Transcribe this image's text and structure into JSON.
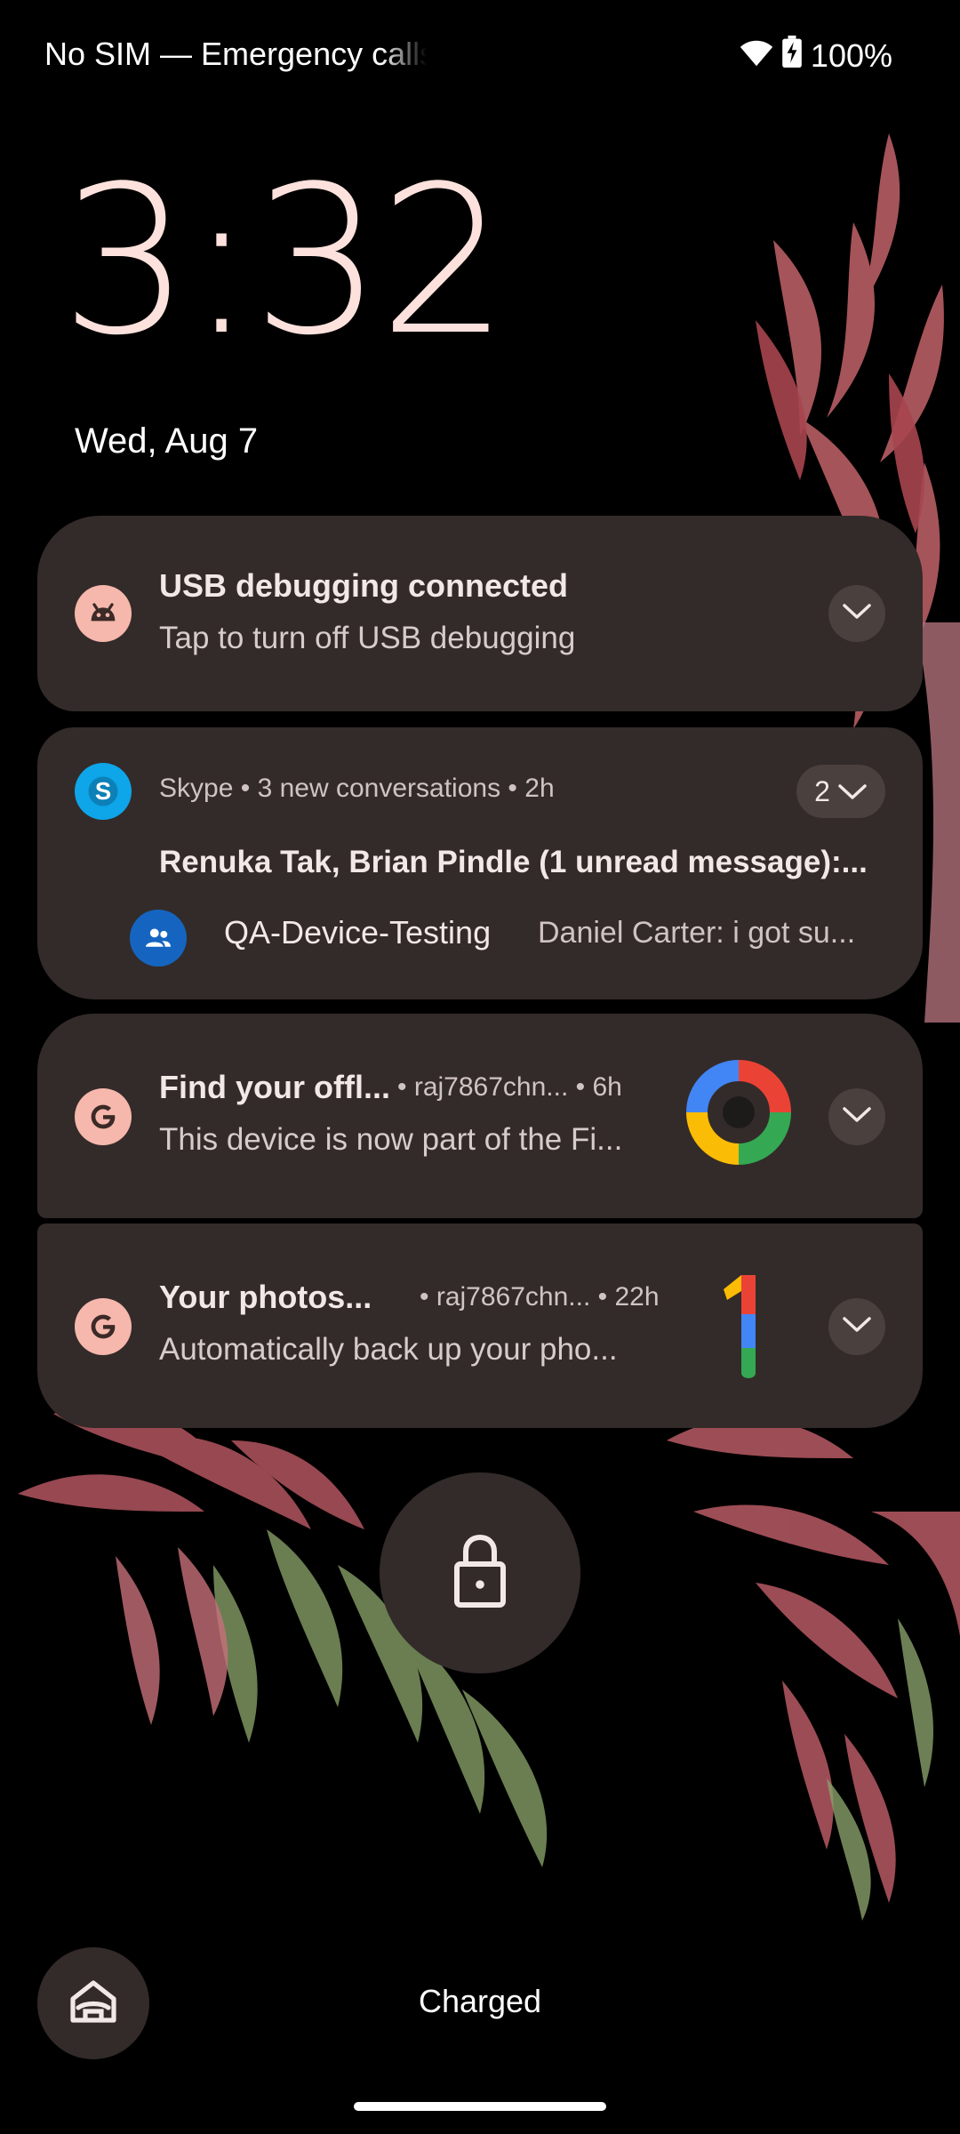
{
  "status_bar": {
    "carrier": "No SIM — Emergency calls only",
    "battery": "100%",
    "icons": [
      "wifi-icon",
      "battery-charging-icon"
    ]
  },
  "lockscreen": {
    "time": "3:32",
    "date": "Wed, Aug 7"
  },
  "notifications": [
    {
      "app_icon": "android-debug-icon",
      "title": "USB debugging connected",
      "text": "Tap to turn off USB debugging"
    },
    {
      "app_icon": "skype-icon",
      "app": "Skype",
      "summary": "3 new conversations",
      "time": "2h",
      "count": "2",
      "title": "Renuka Tak, Brian Pindle (1 unread message):...",
      "conversation": {
        "name": "QA-Device-Testing",
        "message": "Daniel Carter: i got su..."
      }
    },
    {
      "app_icon": "google-g-icon",
      "title": "Find your offl...",
      "account": "raj7867chn...",
      "time": "6h",
      "text": "This device is now part of the Fi...",
      "thumbnail": "find-hub-logo"
    },
    {
      "app_icon": "google-g-icon",
      "title": "Your photos...",
      "account": "raj7867chn...",
      "time": "22h",
      "text": "Automatically back up your pho...",
      "thumbnail": "google-one-logo"
    }
  ],
  "bottom": {
    "charging_status": "Charged"
  },
  "colors": {
    "card_bg": "#332b29",
    "clock": "#fde1dc",
    "icon_pink": "#f6b7ac",
    "skype_blue": "#0ea5e9"
  }
}
